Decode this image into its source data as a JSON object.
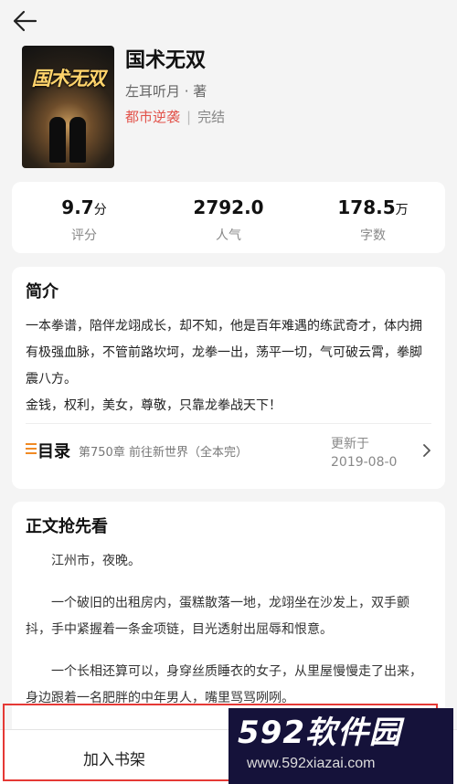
{
  "book": {
    "title": "国术无双",
    "cover_title": "国术无双",
    "author": "左耳听月 · 著",
    "category": "都市逆袭",
    "separator": "|",
    "status": "完结"
  },
  "stats": [
    {
      "value": "9.7",
      "unit": "分",
      "label": "评分"
    },
    {
      "value": "2792.0",
      "unit": "",
      "label": "人气"
    },
    {
      "value": "178.5",
      "unit": "万",
      "label": "字数"
    }
  ],
  "intro": {
    "title": "简介",
    "paragraphs": [
      "一本拳谱，陪伴龙翊成长，却不知，他是百年难遇的练武奇才，体内拥有极强血脉，不管前路坎坷，龙拳一出，荡平一切，气可破云霄，拳脚震八方。",
      "金钱，权利，美女，尊敬，只靠龙拳战天下！"
    ]
  },
  "toc": {
    "label": "目录",
    "latest_chapter": "第750章 前往新世界（全本完）",
    "updated_label": "更新于",
    "updated_date": "2019-08-0"
  },
  "preview": {
    "title": "正文抢先看",
    "paragraphs": [
      "江州市，夜晚。",
      "一个破旧的出租房内，蛋糕散落一地，龙翊坐在沙发上，双手颤抖，手中紧握着一条金项链，目光透射出屈辱和恨意。",
      "一个长相还算可以，身穿丝质睡衣的女子，从里屋慢慢走了出来，身边跟着一名肥胖的中年男人，嘴里骂骂咧咧。"
    ]
  },
  "bottom": {
    "add_shelf": "加入书架"
  },
  "watermark": {
    "number": "592",
    "name": "软件园",
    "url": "www.592xiazai.com"
  },
  "colors": {
    "accent_red": "#e2524a",
    "toc_orange": "#f08a24",
    "highlight_red": "#e53935"
  }
}
